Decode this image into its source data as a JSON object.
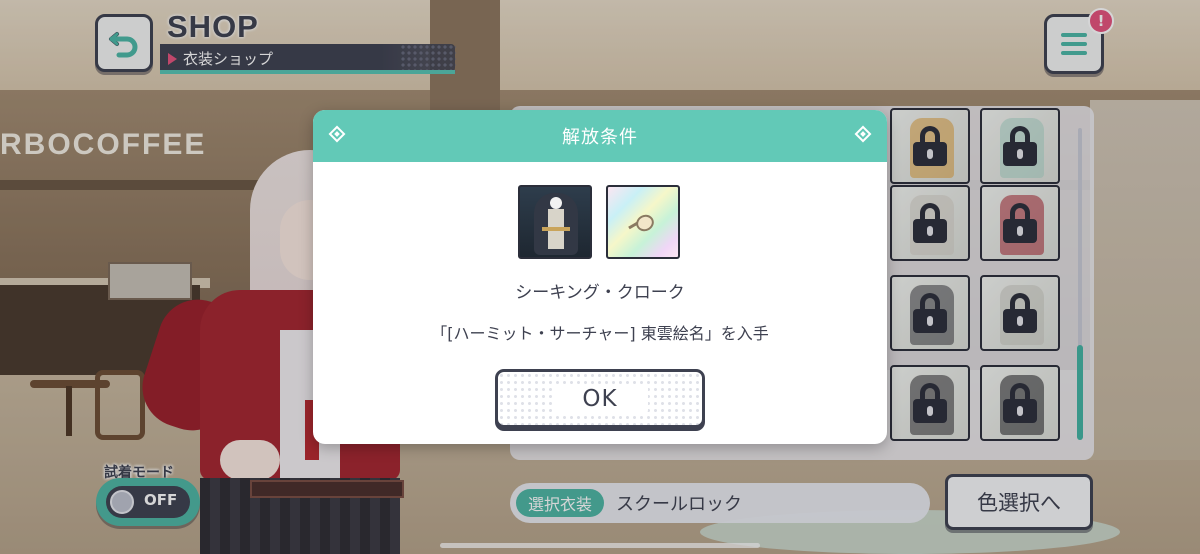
{
  "background": {
    "shop_sign_text": "RBOCOFFEE"
  },
  "header": {
    "title": "SHOP",
    "subtitle": "衣装ショップ",
    "back_icon": "back-arrow-icon",
    "menu_icon": "hamburger-menu-icon",
    "notice_badge": "!"
  },
  "grid": {
    "cells": [
      {
        "outfit_color": "#e2a23a",
        "locked": true
      },
      {
        "outfit_color": "#a9d7c8",
        "locked": true
      },
      {
        "outfit_color": "#d5cfc6",
        "locked": true
      },
      {
        "outfit_color": "#a9202d",
        "locked": true
      },
      {
        "outfit_color": "#3a3a40",
        "locked": true
      },
      {
        "outfit_color": "#c9c9c0",
        "locked": true
      },
      {
        "outfit_color": "#2c2a2e",
        "locked": true
      },
      {
        "outfit_color": "#1c1b1f",
        "locked": true
      }
    ]
  },
  "trial_mode": {
    "label": "試着モード",
    "state": "OFF"
  },
  "selected_costume": {
    "label": "選択衣装",
    "value": "スクールロック"
  },
  "color_select_button": "色選択へ",
  "modal": {
    "title": "解放条件",
    "costume_name": "シーキング・クローク",
    "condition": "「[ハーミット・サーチャー] 東雲絵名」を入手",
    "ok_label": "OK"
  },
  "colors": {
    "accent": "#62c9b7",
    "dark": "#3e4150",
    "pink": "#e6527d"
  }
}
